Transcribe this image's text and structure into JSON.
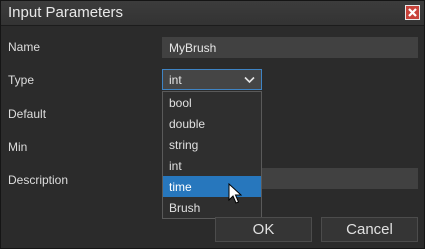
{
  "window": {
    "title": "Input Parameters"
  },
  "labels": {
    "name": "Name",
    "type": "Type",
    "default": "Default",
    "min": "Min",
    "description": "Description"
  },
  "name_field": {
    "value": "MyBrush"
  },
  "type_select": {
    "value": "int"
  },
  "type_options": [
    "bool",
    "double",
    "string",
    "int",
    "time",
    "Brush"
  ],
  "highlighted_option": "time",
  "buttons": {
    "ok": "OK",
    "cancel": "Cancel"
  },
  "colors": {
    "accent": "#2777bd",
    "focus_border": "#3f84c4",
    "close_button": "#c8423a"
  },
  "icons": {
    "close": "close-icon",
    "dropdown": "chevron-down-icon",
    "cursor": "mouse-pointer-icon"
  }
}
